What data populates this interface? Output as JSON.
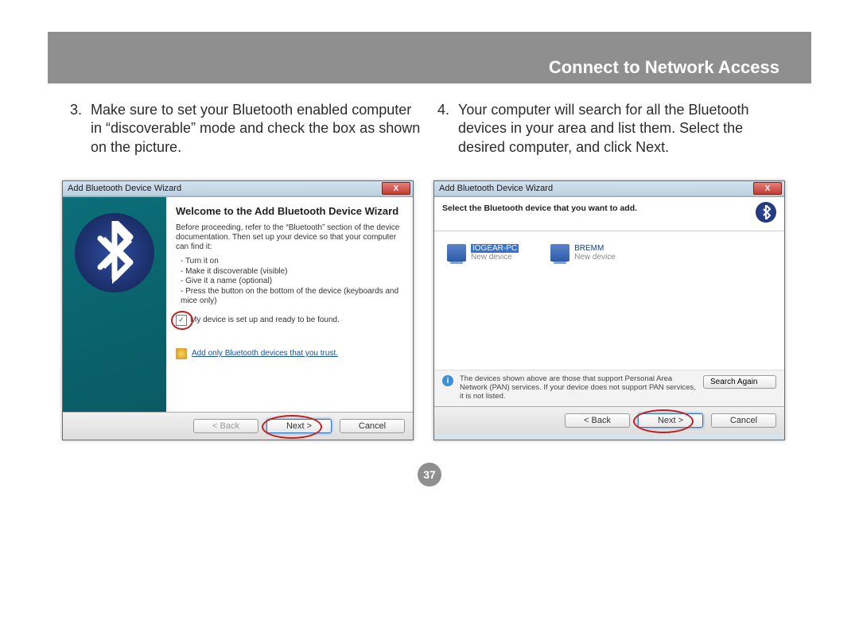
{
  "header": {
    "title": "Connect to Network Access"
  },
  "steps": {
    "s3_num": "3.",
    "s3_text": "Make sure to set your Bluetooth enabled computer in “discoverable” mode and check the box as shown on the picture.",
    "s4_num": "4.",
    "s4_text": "Your computer will search for all the Bluetooth devices in your area and list them. Select the desired computer, and click Next."
  },
  "dialog1": {
    "title": "Add Bluetooth Device Wizard",
    "close": "X",
    "welcome": "Welcome to the Add Bluetooth Device Wizard",
    "intro": "Before proceeding, refer to the “Bluetooth” section of the device documentation. Then set up your device so that your computer can find it:",
    "bullets": [
      "Turn it on",
      "Make it discoverable (visible)",
      "Give it a name (optional)",
      "Press the button on the bottom of the device (keyboards and mice only)"
    ],
    "ready_check": "✓",
    "ready_label": "My device is set up and ready to be found.",
    "trust": "Add only Bluetooth devices that you trust.",
    "btn_back": "< Back",
    "btn_next": "Next >",
    "btn_cancel": "Cancel"
  },
  "dialog2": {
    "title": "Add Bluetooth Device Wizard",
    "close": "X",
    "heading": "Select the Bluetooth device that you want to add.",
    "devices": [
      {
        "name": "IOGEAR-PC",
        "sub": "New device",
        "selected": true
      },
      {
        "name": "BREMM",
        "sub": "New device",
        "selected": false
      }
    ],
    "info_i": "i",
    "info": "The devices shown above are those that support Personal Area Network (PAN) services. If your device does not support PAN services, it is not listed.",
    "search": "Search Again",
    "btn_back": "< Back",
    "btn_next": "Next >",
    "btn_cancel": "Cancel"
  },
  "page_number": "37"
}
